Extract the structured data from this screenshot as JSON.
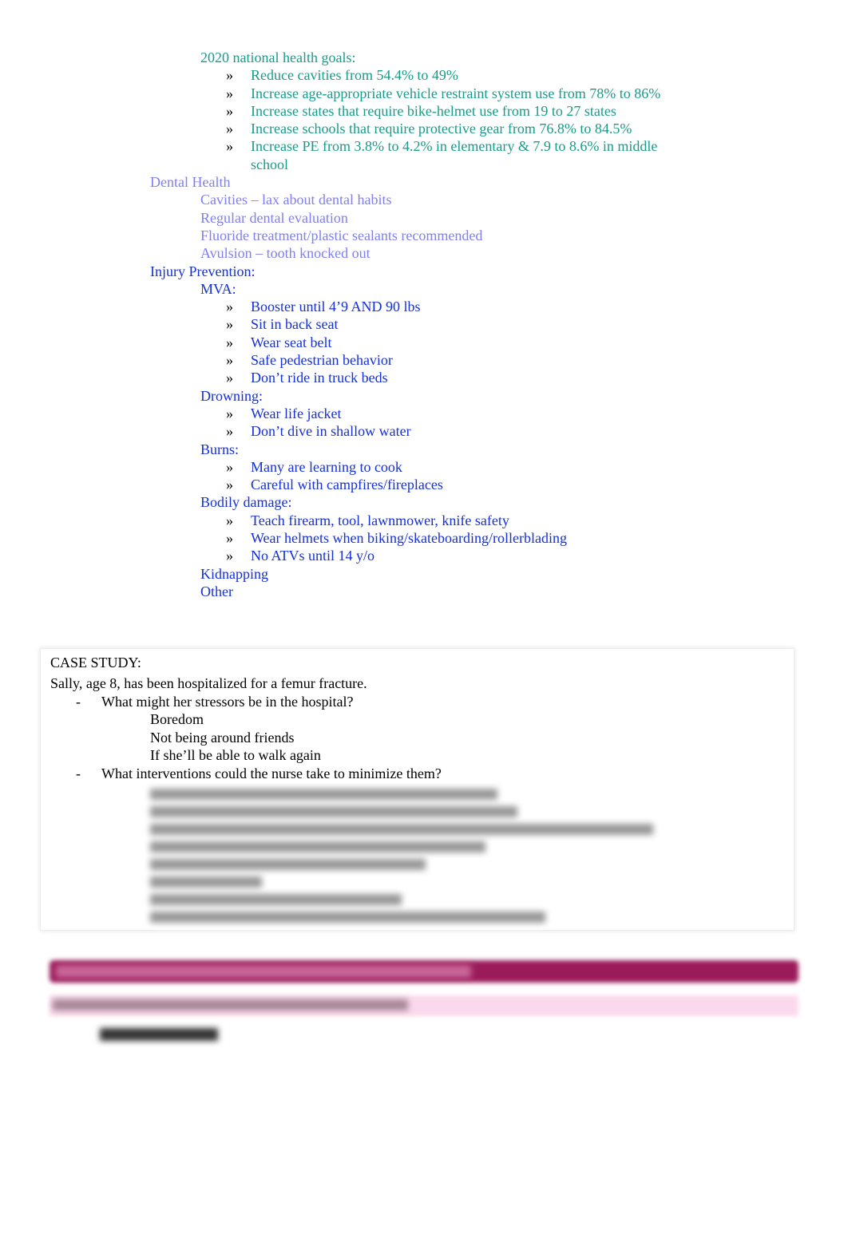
{
  "bullet_glyph": "",
  "arrow_glyph": "»",
  "dash_glyph": "-",
  "colors": {
    "teal": "#1a9a8a",
    "lavender": "#7f7ff0",
    "blue": "#1530d8",
    "banner": "#9b1b5a",
    "banner_light": "#fbd9ec"
  },
  "outline": [
    {
      "level": 2,
      "color": "teal",
      "text": "2020 national health goals:"
    },
    {
      "level": 3,
      "color": "teal",
      "text": "Reduce cavities from 54.4% to 49%"
    },
    {
      "level": 3,
      "color": "teal",
      "text": "Increase age-appropriate vehicle restraint system use from 78% to 86%"
    },
    {
      "level": 3,
      "color": "teal",
      "text": "Increase states that require bike-helmet use from 19 to 27 states"
    },
    {
      "level": 3,
      "color": "teal",
      "text": "Increase schools that require protective gear from 76.8% to 84.5%"
    },
    {
      "level": 3,
      "color": "teal",
      "text": "Increase PE from 3.8% to 4.2% in elementary & 7.9 to 8.6% in middle school"
    },
    {
      "level": 1,
      "color": "lav",
      "text": "Dental Health"
    },
    {
      "level": 2,
      "color": "lav",
      "text": "Cavities – lax about dental habits"
    },
    {
      "level": 2,
      "color": "lav",
      "text": "Regular dental evaluation"
    },
    {
      "level": 2,
      "color": "lav",
      "text": "Fluoride treatment/plastic sealants recommended"
    },
    {
      "level": 2,
      "color": "lav",
      "text": "Avulsion – tooth knocked out"
    },
    {
      "level": 1,
      "color": "blue",
      "text": "Injury Prevention:"
    },
    {
      "level": 2,
      "color": "blue",
      "text": "MVA:"
    },
    {
      "level": 3,
      "color": "blue",
      "text": "Booster until 4’9 AND 90 lbs"
    },
    {
      "level": 3,
      "color": "blue",
      "text": "Sit in back seat"
    },
    {
      "level": 3,
      "color": "blue",
      "text": "Wear seat belt"
    },
    {
      "level": 3,
      "color": "blue",
      "text": "Safe pedestrian behavior"
    },
    {
      "level": 3,
      "color": "blue",
      "text": "Don’t ride in truck beds"
    },
    {
      "level": 2,
      "color": "blue",
      "text": "Drowning:"
    },
    {
      "level": 3,
      "color": "blue",
      "text": "Wear life jacket"
    },
    {
      "level": 3,
      "color": "blue",
      "text": "Don’t dive in shallow water"
    },
    {
      "level": 2,
      "color": "blue",
      "text": "Burns:"
    },
    {
      "level": 3,
      "color": "blue",
      "text": "Many are learning to cook"
    },
    {
      "level": 3,
      "color": "blue",
      "text": "Careful with campfires/fireplaces"
    },
    {
      "level": 2,
      "color": "blue",
      "text": "Bodily damage:"
    },
    {
      "level": 3,
      "color": "blue",
      "text": "Teach firearm, tool, lawnmower, knife safety"
    },
    {
      "level": 3,
      "color": "blue",
      "text": "Wear helmets when biking/skateboarding/rollerblading"
    },
    {
      "level": 3,
      "color": "blue",
      "text": "No ATVs until 14 y/o"
    },
    {
      "level": 2,
      "color": "blue",
      "text": "Kidnapping"
    },
    {
      "level": 2,
      "color": "blue",
      "text": "Other"
    }
  ],
  "case_study": {
    "heading": "CASE STUDY:",
    "intro": "Sally, age 8, has been hospitalized for a femur fracture.",
    "q1": "What might her stressors be in the hospital?",
    "q1_answers": [
      "Boredom",
      "Not being around friends",
      "If she’ll be able to walk again"
    ],
    "q2": "What interventions could the nurse take to minimize them?"
  }
}
